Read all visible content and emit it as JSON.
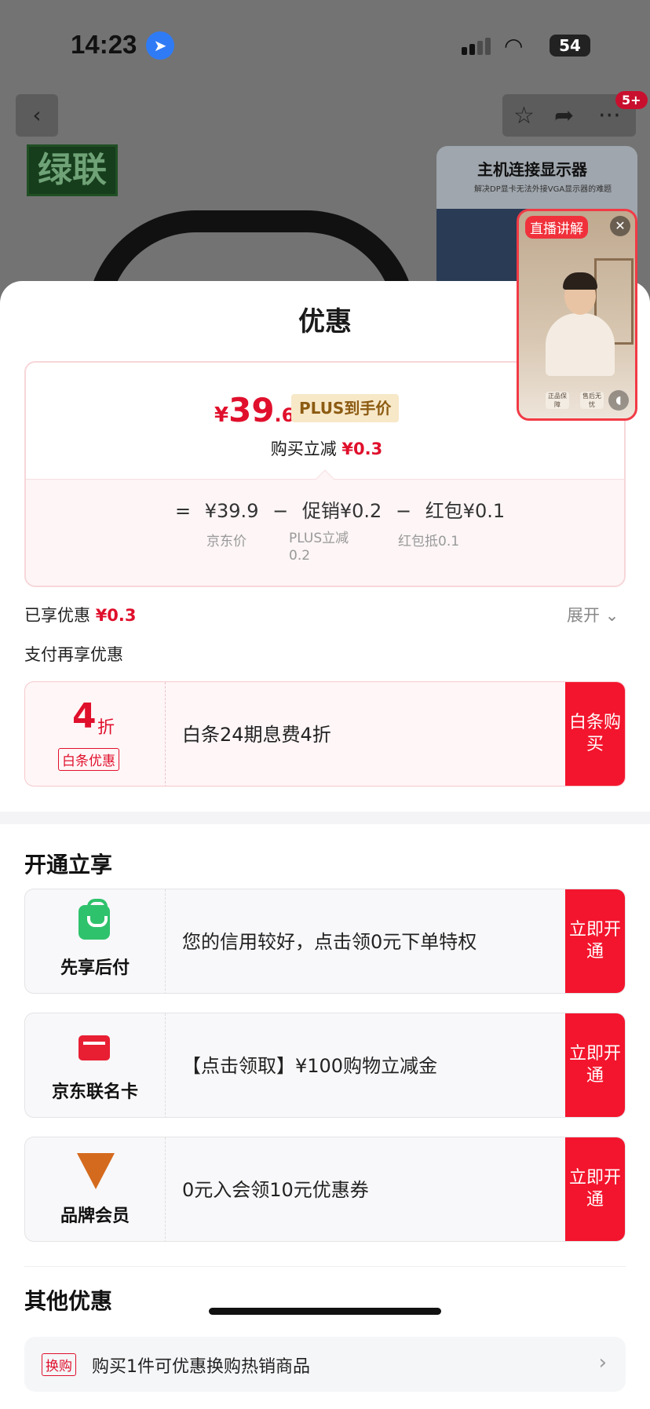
{
  "status_bar": {
    "time": "14:23",
    "battery": "54"
  },
  "background": {
    "brand_logo": "绿联",
    "badge": "5+",
    "promo_title": "主机连接显示器",
    "promo_subtitle": "解决DP显卡无法外接VGA显示器的难题"
  },
  "live": {
    "tag": "直播讲解",
    "button_1": "正品保障",
    "button_2": "售后无忧"
  },
  "sheet": {
    "title": "优惠",
    "price": {
      "yen": "¥",
      "integer": "39",
      "decimal": ".6",
      "plus_tag": "PLUS到手价",
      "reduce_label": "购买立减",
      "reduce_value": "¥0.3"
    },
    "breakdown": {
      "eq": "=",
      "jd_price": "¥39.9",
      "minus1": "−",
      "promo": "促销¥0.2",
      "minus2": "−",
      "redpacket": "红包¥0.1",
      "jd_label": "京东价",
      "promo_label": "PLUS立减0.2",
      "redpacket_label": "红包抵0.1"
    },
    "enjoyed_label": "已享优惠",
    "enjoyed_value": "¥0.3",
    "expand": "展开",
    "pay_more": "支付再享优惠",
    "baitiao": {
      "num": "4",
      "unit": "折",
      "tag": "白条优惠",
      "text": "白条24期息费4折",
      "cta": "白条购买"
    },
    "open_title": "开通立享",
    "open_items": [
      {
        "label": "先享后付",
        "text": "您的信用较好，点击领0元下单特权",
        "cta": "立即开通",
        "icon": "shopping-bag-icon"
      },
      {
        "label": "京东联名卡",
        "text": "【点击领取】¥100购物立减金",
        "cta": "立即开通",
        "icon": "credit-card-icon"
      },
      {
        "label": "品牌会员",
        "text": "0元入会领10元优惠券",
        "cta": "立即开通",
        "icon": "brand-v-icon"
      }
    ],
    "other_title": "其他优惠",
    "other_item": {
      "tag": "换购",
      "text": "购买1件可优惠换购热销商品"
    }
  },
  "colors": {
    "accent": "#f3152d",
    "price_red": "#e0102c",
    "plus_gold": "#8c5b12",
    "green": "#2fc26c"
  }
}
